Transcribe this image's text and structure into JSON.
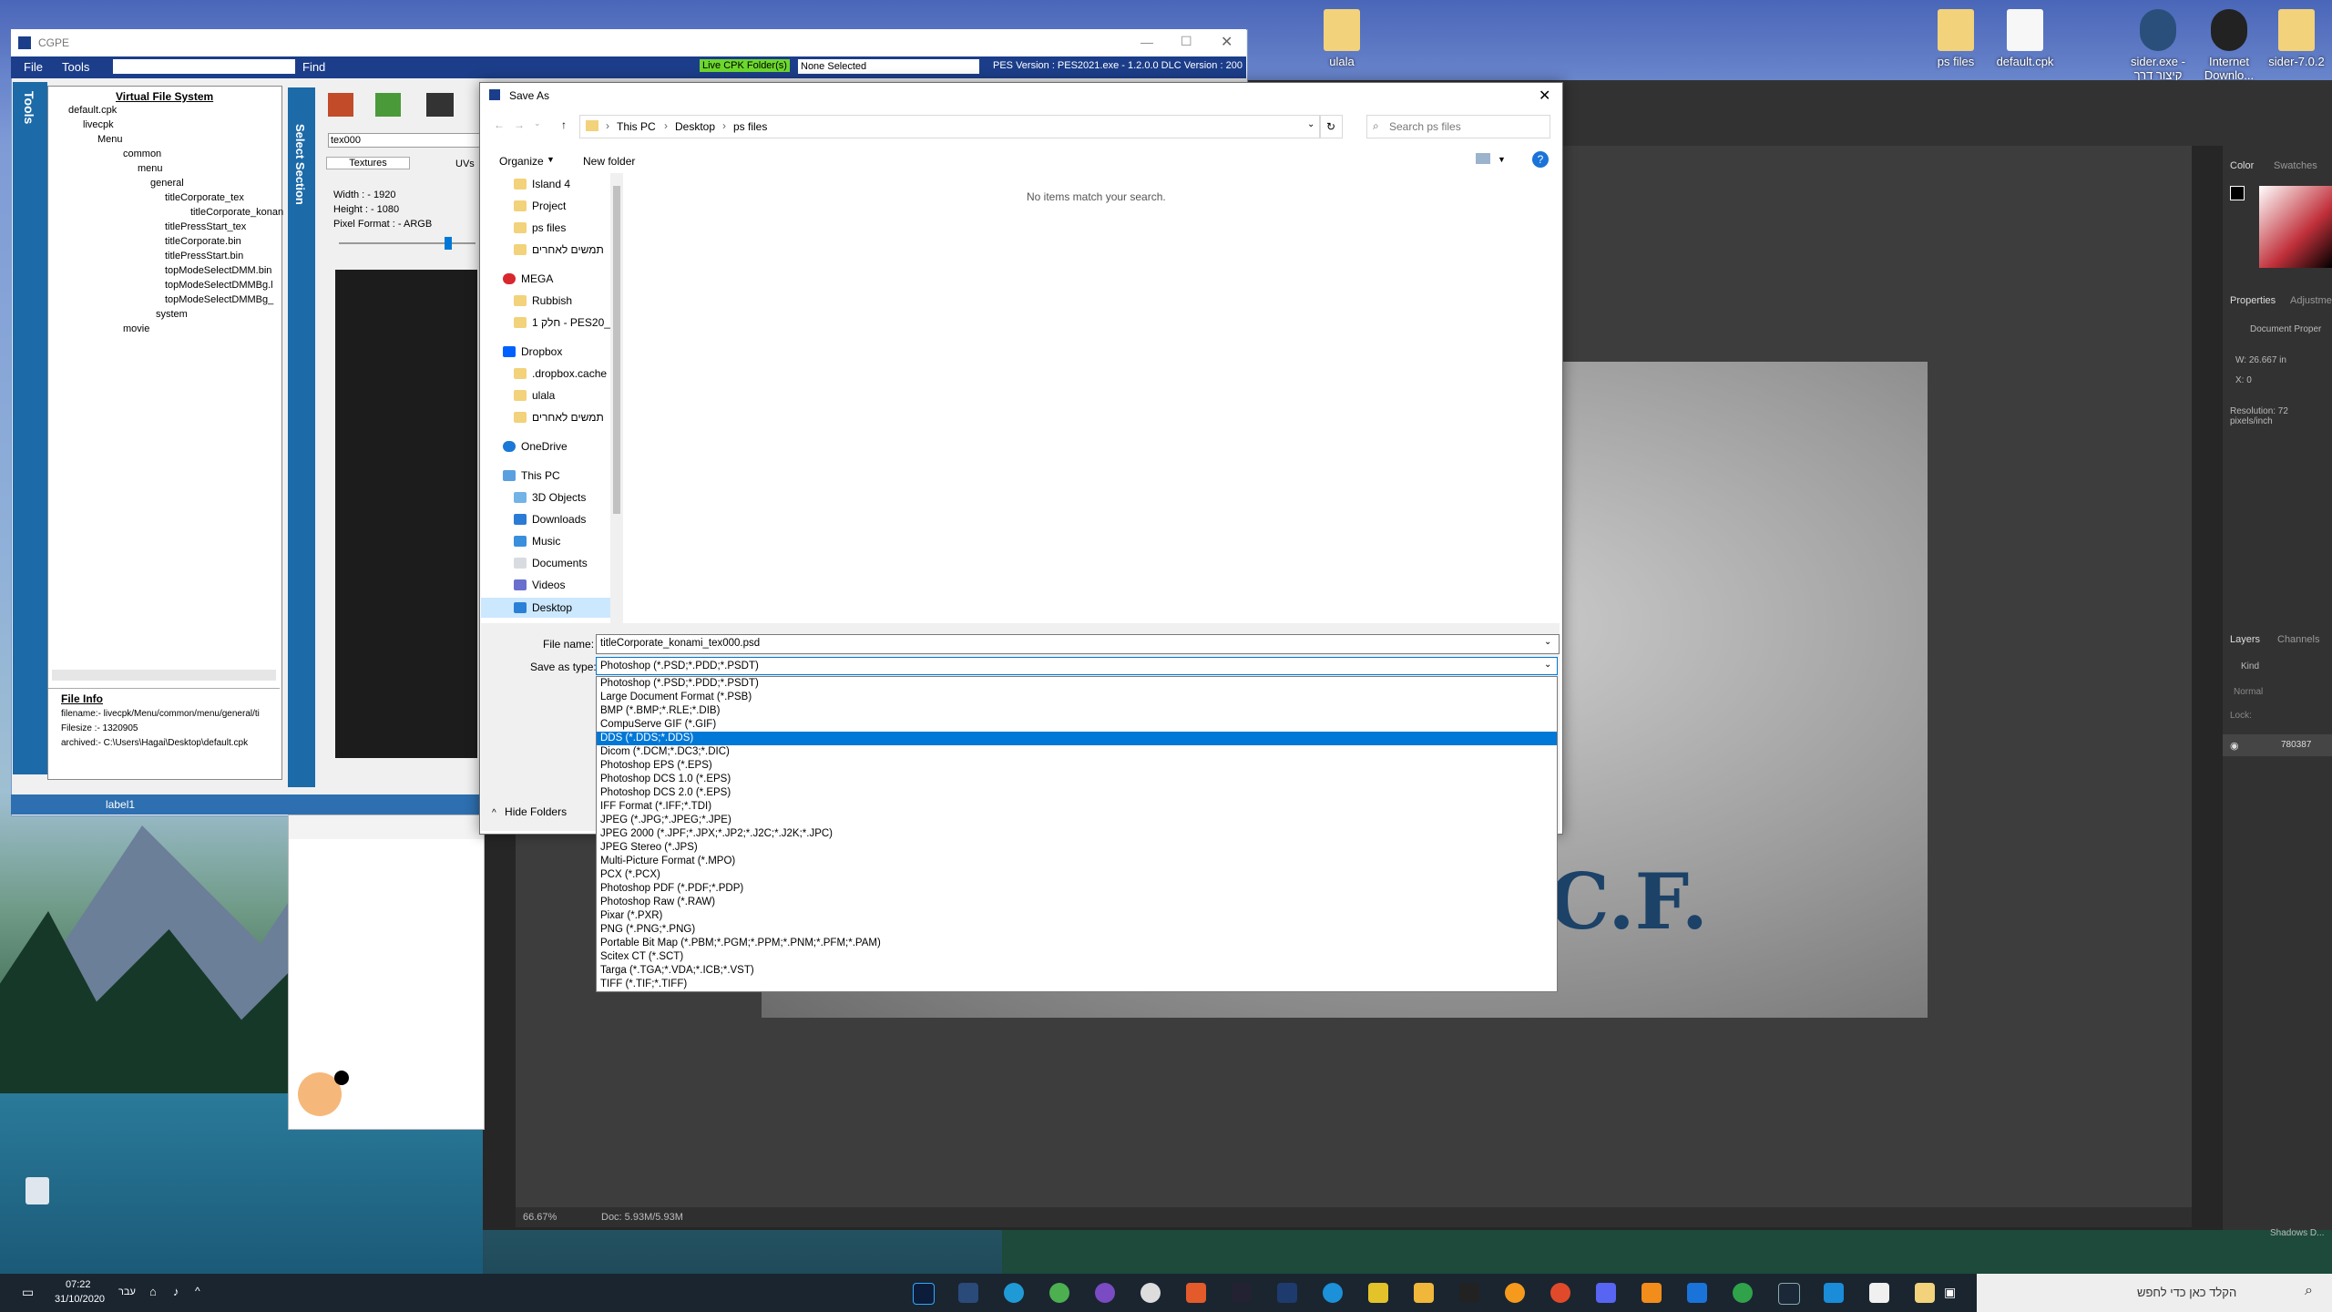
{
  "desktop": {
    "icons": [
      {
        "label": "ulala"
      },
      {
        "label": "ps files"
      },
      {
        "label": "default.cpk"
      },
      {
        "label": "sider.exe - קיצור דרך"
      },
      {
        "label": "Internet Downlo..."
      },
      {
        "label": "sider-7.0.2"
      }
    ]
  },
  "cgpe": {
    "title": "CGPE",
    "menu": {
      "file": "File",
      "tools": "Tools",
      "find": "Find"
    },
    "live_cpk": "Live CPK Folder(s)",
    "selection": "None Selected",
    "version": "PES Version : PES2021.exe - 1.2.0.0  DLC Version : 200",
    "vfs_title": "Virtual File System",
    "tree": [
      "default.cpk",
      "livecpk",
      "Menu",
      "common",
      "menu",
      "general",
      "titleCorporate_tex",
      "titleCorporate_konan",
      "titlePressStart_tex",
      "titleCorporate.bin",
      "titlePressStart.bin",
      "topModeSelectDMM.bin",
      "topModeSelectDMMBg.l",
      "topModeSelectDMMBg_",
      "system",
      "movie"
    ],
    "tools_label": "Tools",
    "select_label": "Select Section",
    "tex_name": "tex000",
    "tab_textures": "Textures",
    "tab_uvs": "UVs",
    "width": "Width : - 1920",
    "height": "Height : - 1080",
    "pixel_format": "Pixel Format : - ARGB",
    "file_info_title": "File Info",
    "filename": "filename:- livecpk/Menu/common/menu/general/ti",
    "filesize": "Filesize :- 1320905",
    "archived": "archived:- C:\\Users\\Hagai\\Desktop\\default.cpk",
    "status_label": "label1"
  },
  "dialog": {
    "title": "Save As",
    "breadcrumb": [
      "This PC",
      "Desktop",
      "ps files"
    ],
    "search_placeholder": "Search ps files",
    "organize": "Organize",
    "new_folder": "New folder",
    "empty_msg": "No items match your search.",
    "nav": [
      "Island 4",
      "Project",
      "ps files",
      "תמשים לאחרים",
      "MEGA",
      "Rubbish",
      "1 חלק - PES20_P",
      "Dropbox",
      ".dropbox.cache",
      "ulala",
      "תמשים לאחרים",
      "OneDrive",
      "This PC",
      "3D Objects",
      "Downloads",
      "Music",
      "Documents",
      "Videos",
      "Desktop"
    ],
    "file_name_label": "File name:",
    "file_name_value": "titleCorporate_konami_tex000.psd",
    "save_type_label": "Save as type:",
    "save_type_value": "Photoshop (*.PSD;*.PDD;*.PSDT)",
    "hide_folders": "Hide Folders",
    "types": [
      "Photoshop (*.PSD;*.PDD;*.PSDT)",
      "Large Document Format (*.PSB)",
      "BMP (*.BMP;*.RLE;*.DIB)",
      "CompuServe GIF (*.GIF)",
      "DDS (*.DDS;*.DDS)",
      "Dicom (*.DCM;*.DC3;*.DIC)",
      "Photoshop EPS (*.EPS)",
      "Photoshop DCS 1.0 (*.EPS)",
      "Photoshop DCS 2.0 (*.EPS)",
      "IFF Format (*.IFF;*.TDI)",
      "JPEG (*.JPG;*.JPEG;*.JPE)",
      "JPEG 2000 (*.JPF;*.JPX;*.JP2;*.J2C;*.J2K;*.JPC)",
      "JPEG Stereo (*.JPS)",
      "Multi-Picture Format (*.MPO)",
      "PCX (*.PCX)",
      "Photoshop PDF (*.PDF;*.PDP)",
      "Photoshop Raw (*.RAW)",
      "Pixar (*.PXR)",
      "PNG (*.PNG;*.PNG)",
      "Portable Bit Map (*.PBM;*.PGM;*.PPM;*.PNM;*.PFM;*.PAM)",
      "Scitex CT (*.SCT)",
      "Targa (*.TGA;*.VDA;*.ICB;*.VST)",
      "TIFF (*.TIF;*.TIFF)"
    ],
    "selected_type_index": 4
  },
  "photoshop": {
    "logo_text": "C.F.",
    "zoom": "66.67%",
    "doc": "Doc: 5.93M/5.93M",
    "color_tab": "Color",
    "swatches_tab": "Swatches",
    "properties_tab": "Properties",
    "adjustments_tab": "Adjustme",
    "doc_props": "Document Proper",
    "w_value": "W: 26.667 in",
    "x_value": "X: 0",
    "resolution": "Resolution: 72 pixels/inch",
    "layers_tab": "Layers",
    "channels_tab": "Channels",
    "kind": "Kind",
    "blend_mode": "Normal",
    "lock_label": "Lock:",
    "layer_name": "780387",
    "shadows": "Shadows D..."
  },
  "taskbar": {
    "time": "07:22",
    "date": "31/10/2020",
    "lang": "עבר",
    "search": "הקלד כאן כדי לחפש"
  }
}
